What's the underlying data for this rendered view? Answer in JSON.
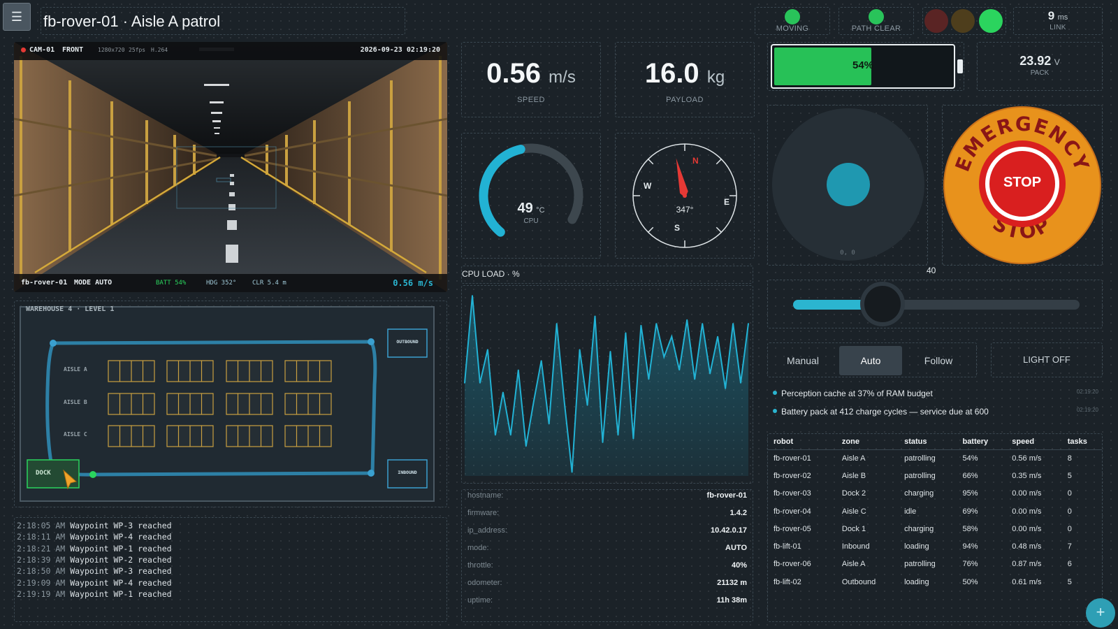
{
  "header": {
    "menu_icon": "hamburger-menu-icon",
    "title": "fb-rover-01 · Aisle A patrol"
  },
  "status": {
    "moving_label": "MOVING",
    "path_label": "PATH CLEAR",
    "link_value": "9",
    "link_unit": "ms",
    "link_label": "LINK",
    "traffic_light_active": "green"
  },
  "camera": {
    "cam_id": "CAM-01",
    "view": "FRONT",
    "resolution": "1280x720",
    "fps": "25fps",
    "codec": "H.264",
    "timestamp": "2026-09-23 02:19:20",
    "robot": "fb-rover-01",
    "mode": "MODE AUTO",
    "batt": "BATT 54%",
    "hdg": "HDG 352°",
    "clr": "CLR 5.4 m",
    "speed": "0.56 m/s"
  },
  "map": {
    "title": "WAREHOUSE 4 · LEVEL 1",
    "aisles": [
      "AISLE A",
      "AISLE B",
      "AISLE C"
    ],
    "outbound": "OUTBOUND",
    "inbound": "INBOUND",
    "dock": "DOCK"
  },
  "log": [
    {
      "time": "2:18:05 AM",
      "msg": "Waypoint WP-3 reached"
    },
    {
      "time": "2:18:11 AM",
      "msg": "Waypoint WP-4 reached"
    },
    {
      "time": "2:18:21 AM",
      "msg": "Waypoint WP-1 reached"
    },
    {
      "time": "2:18:39 AM",
      "msg": "Waypoint WP-2 reached"
    },
    {
      "time": "2:18:50 AM",
      "msg": "Waypoint WP-3 reached"
    },
    {
      "time": "2:19:09 AM",
      "msg": "Waypoint WP-4 reached"
    },
    {
      "time": "2:19:19 AM",
      "msg": "Waypoint WP-1 reached"
    }
  ],
  "speed": {
    "value": "0.56",
    "unit": "m/s",
    "label": "SPEED"
  },
  "payload": {
    "value": "16.0",
    "unit": "kg",
    "label": "PAYLOAD"
  },
  "cpu_temp": {
    "value": "49",
    "unit": "°C",
    "label": "CPU",
    "fraction": 0.49
  },
  "compass": {
    "heading": "347°",
    "heading_deg": 347,
    "n": "N",
    "e": "E",
    "s": "S",
    "w": "W"
  },
  "battery": {
    "percent_label": "54%",
    "fraction": 0.54
  },
  "pack": {
    "value": "23.92",
    "unit": "V",
    "label": "PACK"
  },
  "joystick": {
    "readout": "0, 0"
  },
  "estop": {
    "top_text": "EMERGENCY",
    "center_text": "STOP",
    "bottom_text": "STOP",
    "color": "#e8921c"
  },
  "throttle": {
    "value_label": "40",
    "fraction": 0.4,
    "accent": "#2bb5d0"
  },
  "modes": {
    "items": [
      "Manual",
      "Auto",
      "Follow"
    ],
    "active": "Auto"
  },
  "light_button": "LIGHT OFF",
  "alerts": [
    {
      "text": "Perception cache at 37% of RAM budget",
      "time": "02:19:20"
    },
    {
      "text": "Battery pack at 412 charge cycles — service due at 600",
      "time": "02:19:20"
    }
  ],
  "info": {
    "rows": [
      {
        "key": "hostname:",
        "value": "fb-rover-01"
      },
      {
        "key": "firmware:",
        "value": "1.4.2"
      },
      {
        "key": "ip_address:",
        "value": "10.42.0.17"
      },
      {
        "key": "mode:",
        "value": "AUTO"
      },
      {
        "key": "throttle:",
        "value": "40%"
      },
      {
        "key": "odometer:",
        "value": "21132 m"
      },
      {
        "key": "uptime:",
        "value": "11h 38m"
      }
    ]
  },
  "fleet": {
    "headers": [
      "robot",
      "zone",
      "status",
      "battery",
      "speed",
      "tasks"
    ],
    "rows": [
      [
        "fb-rover-01",
        "Aisle A",
        "patrolling",
        "54%",
        "0.56 m/s",
        "8"
      ],
      [
        "fb-rover-02",
        "Aisle B",
        "patrolling",
        "66%",
        "0.35 m/s",
        "5"
      ],
      [
        "fb-rover-03",
        "Dock 2",
        "charging",
        "95%",
        "0.00 m/s",
        "0"
      ],
      [
        "fb-rover-04",
        "Aisle C",
        "idle",
        "69%",
        "0.00 m/s",
        "0"
      ],
      [
        "fb-rover-05",
        "Dock 1",
        "charging",
        "58%",
        "0.00 m/s",
        "0"
      ],
      [
        "fb-lift-01",
        "Inbound",
        "loading",
        "94%",
        "0.48 m/s",
        "7"
      ],
      [
        "fb-rover-06",
        "Aisle A",
        "patrolling",
        "76%",
        "0.87 m/s",
        "6"
      ],
      [
        "fb-lift-02",
        "Outbound",
        "loading",
        "50%",
        "0.61 m/s",
        "5"
      ]
    ]
  },
  "fab_icon": "plus-icon",
  "chart_data": {
    "type": "area",
    "title": "CPU LOAD · %",
    "ylim": [
      0,
      100
    ],
    "series": [
      {
        "values": [
          50,
          97,
          50,
          68,
          22,
          45,
          22,
          57,
          16,
          40,
          62,
          28,
          82,
          40,
          2,
          68,
          38,
          86,
          18,
          67,
          22,
          77,
          20,
          81,
          52,
          82,
          64,
          75,
          57,
          84,
          52,
          82,
          55,
          75,
          47,
          82,
          50,
          82
        ]
      }
    ]
  }
}
